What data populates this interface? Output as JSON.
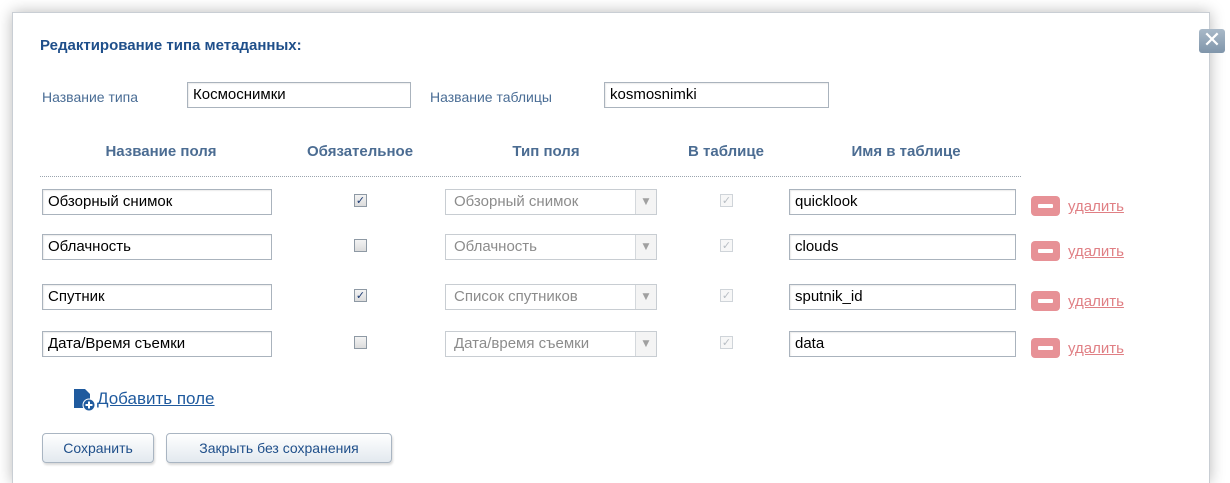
{
  "dialog": {
    "title": "Редактирование типа метаданных:",
    "close_symbol": "✕"
  },
  "type_name": {
    "label": "Название типа",
    "value": "Космоснимки"
  },
  "table_name": {
    "label": "Название таблицы",
    "value": "kosmosnimki"
  },
  "columns": [
    "Название поля",
    "Обязательное",
    "Тип поля",
    "В таблице",
    "Имя в таблице"
  ],
  "fields": [
    {
      "name": "Обзорный снимок",
      "required": true,
      "type": "Обзорный снимок",
      "in_table": true,
      "table_name": "quicklook",
      "delete_label": "удалить"
    },
    {
      "name": "Облачность",
      "required": false,
      "type": "Облачность",
      "in_table": true,
      "table_name": "clouds",
      "delete_label": "удалить"
    },
    {
      "name": "Спутник",
      "required": true,
      "type": "Список спутников",
      "in_table": true,
      "table_name": "sputnik_id",
      "delete_label": "удалить"
    },
    {
      "name": "Дата/Время съемки",
      "required": false,
      "type": "Дата/время съемки",
      "in_table": true,
      "table_name": "data",
      "delete_label": "удалить"
    }
  ],
  "add_field_label": "Добавить поле",
  "buttons": {
    "save": "Сохранить",
    "close_no_save": "Закрыть без сохранения"
  },
  "icons": {
    "close": "close-icon",
    "add_field": "add-document-icon",
    "delete": "minus-icon"
  },
  "colors": {
    "title": "#1f4f8a",
    "label": "#4a6d95",
    "delete": "#e79196",
    "link": "#1f5a9e"
  }
}
